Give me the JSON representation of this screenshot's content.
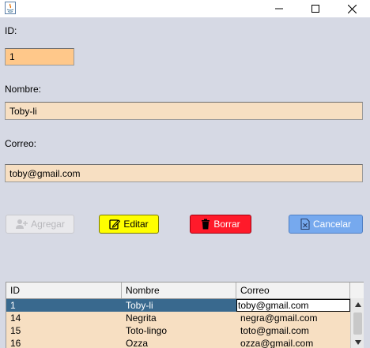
{
  "window": {
    "title": ""
  },
  "form": {
    "id_label": "ID:",
    "id_value": "1",
    "nombre_label": "Nombre:",
    "nombre_value": "Toby-li",
    "correo_label": "Correo:",
    "correo_value": "toby@gmail.com"
  },
  "buttons": {
    "agregar": "Agregar",
    "editar": "Editar",
    "borrar": "Borrar",
    "cancelar": "Cancelar"
  },
  "table": {
    "headers": [
      "ID",
      "Nombre",
      "Correo"
    ],
    "rows": [
      [
        "1",
        "Toby-li",
        "toby@gmail.com"
      ],
      [
        "14",
        "Negrita",
        "negra@gmail.com"
      ],
      [
        "15",
        "Toto-lingo",
        "toto@gmail.com"
      ],
      [
        "16",
        "Ozza",
        "ozza@gmail.com"
      ]
    ],
    "selected_row": 0
  },
  "colors": {
    "background": "#d6d9e4",
    "field_id": "#ffc88a",
    "field_text": "#f7dfc2",
    "editar": "#ffff00",
    "borrar": "#ff1a2a",
    "cancelar": "#76a9ee",
    "selection": "#39698e"
  }
}
